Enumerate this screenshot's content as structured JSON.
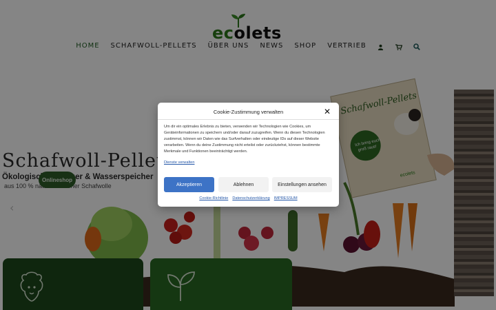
{
  "header": {
    "logo_text": "ecolets",
    "nav": [
      {
        "label": "HOME",
        "active": true
      },
      {
        "label": "SCHAFWOLL-PELLETS"
      },
      {
        "label": "ÜBER UNS"
      },
      {
        "label": "NEWS"
      },
      {
        "label": "SHOP"
      },
      {
        "label": "VERTRIEB"
      }
    ],
    "icons": [
      "user-icon",
      "cart-icon",
      "search-icon"
    ]
  },
  "hero": {
    "title": "Schafwoll-Pellets",
    "subtitle": "Ökologischer Dünger & Wasserspeicher",
    "subtitle2": "aus 100 % naturbelassener Schafwolle",
    "shop_button": "Onlineshop",
    "package_text": "Schafwoll-Pellets",
    "package_badge": "Ich bring euch groß raus!",
    "package_brand": "ecolets"
  },
  "cookie_modal": {
    "title": "Cookie-Zustimmung verwalten",
    "body": "Um dir ein optimales Erlebnis zu bieten, verwenden wir Technologien wie Cookies, um Geräteinformationen zu speichern und/oder darauf zuzugreifen. Wenn du diesen Technologien zustimmst, können wir Daten wie das Surfverhalten oder eindeutige IDs auf dieser Website verarbeiten. Wenn du deine Zustimmung nicht erteilst oder zurückziehst, können bestimmte Merkmale und Funktionen beeinträchtigt werden.",
    "manage_link": "Dienste verwalten",
    "accept_label": "Akzeptieren",
    "deny_label": "Ablehnen",
    "settings_label": "Einstellungen ansehen",
    "footer_links": [
      "Cookie-Richtlinie",
      "Datenschutzerklärung",
      "IMPRESSUM"
    ]
  },
  "colors": {
    "brand_green": "#2c7a1c",
    "accept_blue": "#3d73c6",
    "card_dark": "#1e4a1c",
    "card_green": "#2a6a24"
  }
}
